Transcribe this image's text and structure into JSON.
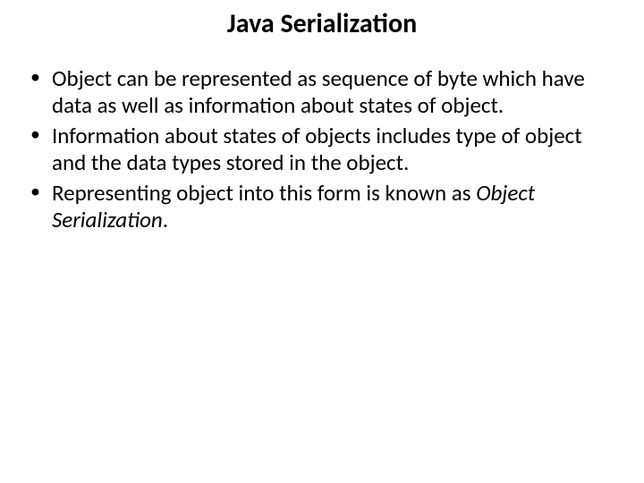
{
  "slide": {
    "title": "Java Serialization",
    "bullets": [
      {
        "text_before": "Object can be represented as sequence of byte which have data as well as information about states of object.",
        "text_italic": "",
        "text_after": ""
      },
      {
        "text_before": " Information about states of objects includes type of object and the data types stored in the object.",
        "text_italic": "",
        "text_after": ""
      },
      {
        "text_before": "Representing object into this form is known as ",
        "text_italic": "Object Serialization",
        "text_after": "."
      }
    ]
  }
}
